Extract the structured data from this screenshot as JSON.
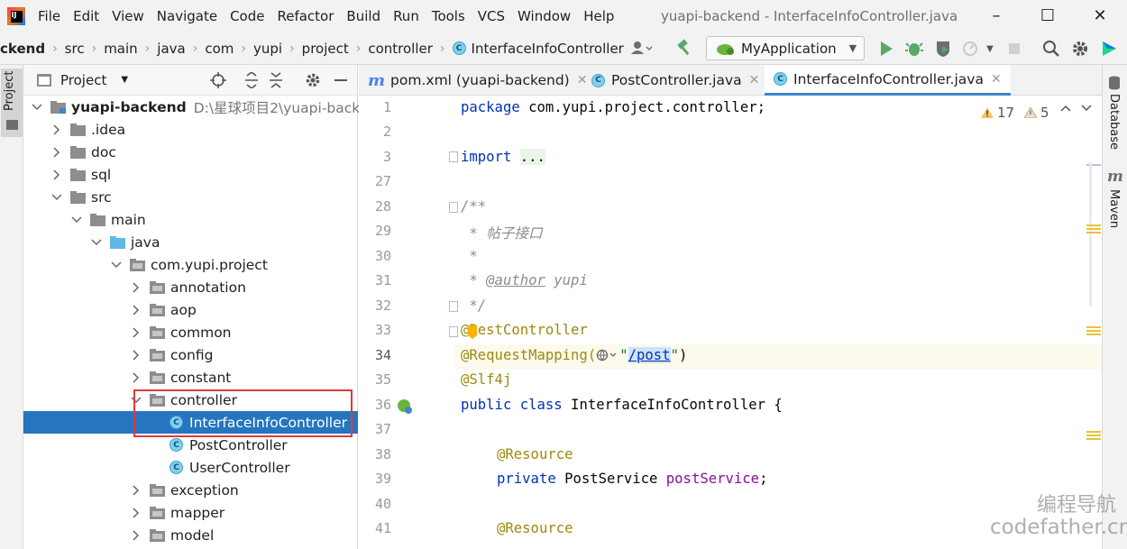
{
  "menu": {
    "items": [
      "File",
      "Edit",
      "View",
      "Navigate",
      "Code",
      "Refactor",
      "Build",
      "Run",
      "Tools",
      "VCS",
      "Window",
      "Help"
    ],
    "window_title": "yuapi-backend - InterfaceInfoController.java"
  },
  "breadcrumb": [
    "ckend",
    "src",
    "main",
    "java",
    "com",
    "yupi",
    "project",
    "controller",
    "InterfaceInfoController"
  ],
  "toolbar": {
    "run_config": "MyApplication"
  },
  "left_stripe": {
    "project_label": "Project"
  },
  "project_panel": {
    "title": "Project",
    "root": {
      "name": "yuapi-backend",
      "path": "D:\\星球项目2\\yuapi-backend"
    },
    "tree": [
      {
        "label": ".idea",
        "level": 1,
        "kind": "folder",
        "expanded": false
      },
      {
        "label": "doc",
        "level": 1,
        "kind": "folder",
        "expanded": false
      },
      {
        "label": "sql",
        "level": 1,
        "kind": "folder",
        "expanded": false
      },
      {
        "label": "src",
        "level": 1,
        "kind": "folder",
        "expanded": true
      },
      {
        "label": "main",
        "level": 2,
        "kind": "folder",
        "expanded": true
      },
      {
        "label": "java",
        "level": 3,
        "kind": "source-folder",
        "expanded": true
      },
      {
        "label": "com.yupi.project",
        "level": 4,
        "kind": "package",
        "expanded": true
      },
      {
        "label": "annotation",
        "level": 5,
        "kind": "package",
        "expanded": false
      },
      {
        "label": "aop",
        "level": 5,
        "kind": "package",
        "expanded": false
      },
      {
        "label": "common",
        "level": 5,
        "kind": "package",
        "expanded": false
      },
      {
        "label": "config",
        "level": 5,
        "kind": "package",
        "expanded": false
      },
      {
        "label": "constant",
        "level": 5,
        "kind": "package",
        "expanded": false
      },
      {
        "label": "controller",
        "level": 5,
        "kind": "package",
        "expanded": true
      },
      {
        "label": "InterfaceInfoController",
        "level": 6,
        "kind": "class",
        "selected": true
      },
      {
        "label": "PostController",
        "level": 6,
        "kind": "class"
      },
      {
        "label": "UserController",
        "level": 6,
        "kind": "class"
      },
      {
        "label": "exception",
        "level": 5,
        "kind": "package",
        "expanded": false
      },
      {
        "label": "mapper",
        "level": 5,
        "kind": "package",
        "expanded": false
      },
      {
        "label": "model",
        "level": 5,
        "kind": "package",
        "expanded": false
      }
    ]
  },
  "tabs": [
    {
      "label": "pom.xml (yuapi-backend)",
      "icon": "maven-icon"
    },
    {
      "label": "PostController.java",
      "icon": "class-icon"
    },
    {
      "label": "InterfaceInfoController.java",
      "icon": "class-icon",
      "active": true
    }
  ],
  "inspections": {
    "warnings": "17",
    "weak_warnings": "5"
  },
  "code": {
    "line_numbers": [
      "1",
      "2",
      "3",
      "27",
      "28",
      "29",
      "30",
      "31",
      "32",
      "33",
      "34",
      "35",
      "36",
      "37",
      "38",
      "39",
      "40",
      "41"
    ],
    "l1_kw": "package",
    "l1_rest": " com.yupi.project.controller;",
    "l3_kw": "import",
    "l3_fold": "...",
    "l28": "/**",
    "l29": " * 帖子接口",
    "l30": " *",
    "l31_pre": " * ",
    "l31_tag": "@author",
    "l31_post": " yupi",
    "l32": " */",
    "l33": "@RestController",
    "l34_ann": "@RequestMapping(",
    "l34_q1": "\"",
    "l34_url": "/post",
    "l34_q2": "\"",
    "l34_end": ")",
    "l35": "@Slf4j",
    "l36_kw": "public class",
    "l36_rest": " InterfaceInfoController {",
    "l38": "@Resource",
    "l39_kw": "private",
    "l39_type": " PostService ",
    "l39_field": "postService",
    "l39_end": ";",
    "l41": "@Resource"
  },
  "right_stripe": {
    "database_label": "Database",
    "maven_label": "Maven"
  },
  "watermark": {
    "cn": "编程导航",
    "en": "codefather.cn"
  }
}
